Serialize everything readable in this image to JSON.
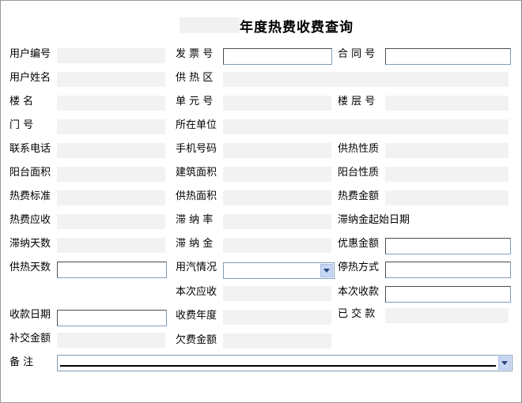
{
  "page": {
    "title": "年度热费收费查询"
  },
  "labels": {
    "user_no": "用户编号",
    "invoice_no": "发 票 号",
    "contract_no": "合 同 号",
    "user_name": "用户姓名",
    "heating_area": "供 热 区",
    "building": "楼      名",
    "unit_no": "单 元 号",
    "floor_no": "楼 层 号",
    "door_no": "门      号",
    "company": "所在单位",
    "phone": "联系电话",
    "mobile": "手机号码",
    "heating_type": "供热性质",
    "balcony_area": "阳台面积",
    "building_area": "建筑面积",
    "balcony_type": "阳台性质",
    "fee_standard": "热费标准",
    "heat_area": "供热面积",
    "fee_amount": "热费金额",
    "fee_due": "热费应收",
    "late_rate": "滞 纳 率",
    "late_start_date": "滞纳金起始日期",
    "late_days": "滞纳天数",
    "late_fee": "滞 纳 金",
    "discount": "优惠金额",
    "heating_days": "供热天数",
    "steam_usage": "用汽情况",
    "stop_method": "停热方式",
    "current_due": "本次应收",
    "current_received": "本次收款",
    "receipt_date": "收款日期",
    "fee_year": "收费年度",
    "paid": "已 交 款",
    "makeup_amount": "补交金额",
    "owed_amount": "欠费金额",
    "remark": "备      注"
  },
  "fields": {
    "invoice_no": "",
    "contract_no": "",
    "discount": "",
    "heating_days": "",
    "steam_usage": "",
    "stop_method": "",
    "current_received": "",
    "receipt_date": "",
    "remark": ""
  }
}
